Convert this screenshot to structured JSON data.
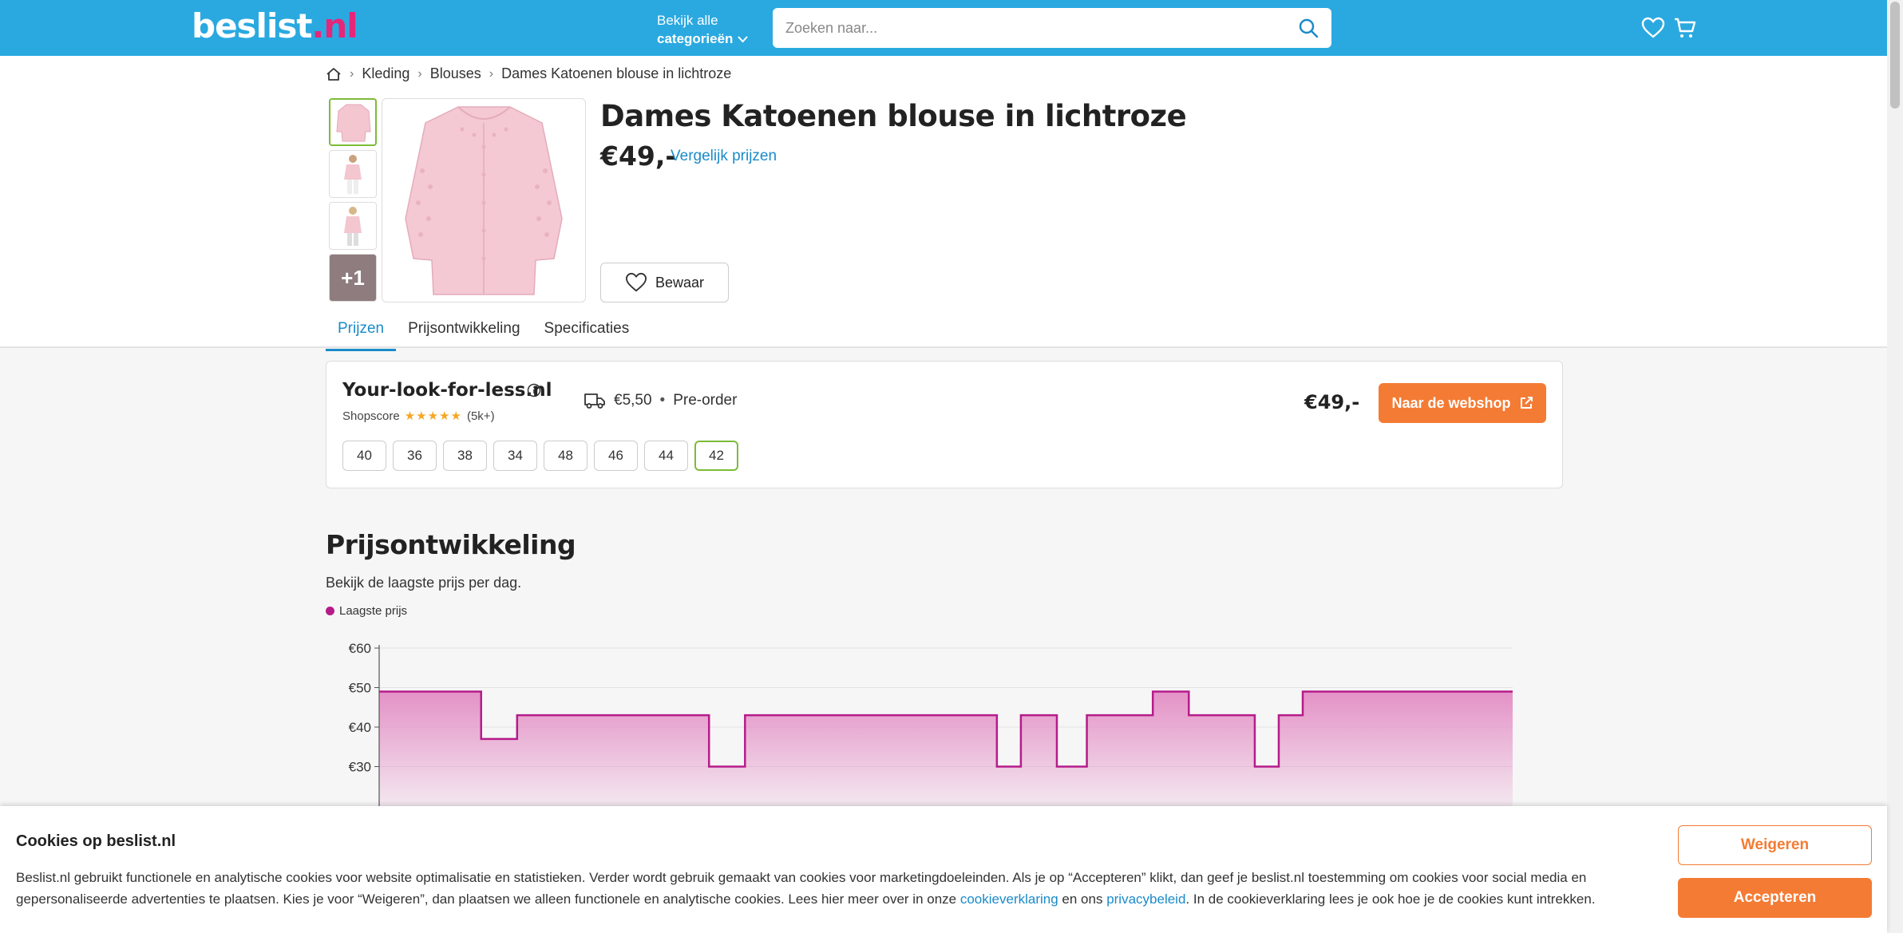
{
  "header": {
    "logo_main": "beslist",
    "logo_tld": ".nl",
    "categories_line1": "Bekijk alle",
    "categories_line2": "categorieën",
    "search_placeholder": "Zoeken naar..."
  },
  "breadcrumb": [
    "Kleding",
    "Blouses",
    "Dames Katoenen blouse in lichtroze"
  ],
  "product": {
    "title": "Dames Katoenen blouse in lichtroze",
    "price": "€49,-",
    "compare_label": "Vergelijk prijzen",
    "save_label": "Bewaar",
    "more_images": "+1",
    "color": "#f3c6d0"
  },
  "tabs": [
    "Prijzen",
    "Prijsontwikkeling",
    "Specificaties"
  ],
  "offer": {
    "shop_name": "Your-look-for-less.nl",
    "shopscore_label": "Shopscore",
    "stars": "★★★★★",
    "rating_count": "(5k+)",
    "shipping": "€5,50",
    "availability": "Pre-order",
    "price": "€49,-",
    "cta": "Naar de webshop",
    "sizes": [
      "40",
      "36",
      "38",
      "34",
      "48",
      "46",
      "44",
      "42"
    ],
    "selected_size": "42"
  },
  "price_history": {
    "title": "Prijsontwikkeling",
    "subtitle": "Bekijk de laagste prijs per dag.",
    "legend": "Laagste prijs"
  },
  "chart_data": {
    "type": "area",
    "title": "",
    "series": [
      {
        "name": "Laagste prijs",
        "x": [
          0,
          8.5,
          11.5,
          27.5,
          30.5,
          51.5,
          53.5,
          56.5,
          59,
          64.5,
          67.5,
          73,
          75,
          77,
          94.5
        ],
        "values": [
          49,
          37,
          43,
          30,
          43,
          30,
          43,
          30,
          43,
          49,
          43,
          30,
          43,
          49,
          49
        ]
      }
    ],
    "y_ticks": [
      "€60",
      "€50",
      "€40",
      "€30"
    ],
    "ylim": [
      0,
      60
    ],
    "grid": true,
    "colors": {
      "line": "#b51c8a",
      "fill": "#e38cc4"
    }
  },
  "cookie": {
    "title": "Cookies op beslist.nl",
    "text_1": "Beslist.nl gebruikt functionele en analytische cookies voor website optimalisatie en statistieken. Verder wordt gebruik gemaakt van cookies voor marketingdoeleinden. Als je op “Accepteren” klikt, dan geef je beslist.nl toestemming om cookies voor social media en gepersonaliseerde advertenties te plaatsen. Kies je voor “Weigeren”, dan plaatsen we alleen functionele en analytische cookies. Lees hier meer over in onze ",
    "link_1": "cookieverklaring",
    "text_2": " en ons ",
    "link_2": "privacybeleid",
    "text_3": ". In de cookieverklaring lees je ook hoe je de cookies kunt intrekken.",
    "refuse": "Weigeren",
    "accept": "Accepteren"
  },
  "colors": {
    "brand_blue": "#2aa9e0",
    "accent_orange": "#f47b34",
    "link_blue": "#1a8bc9",
    "selected_green": "#7dbb38"
  }
}
